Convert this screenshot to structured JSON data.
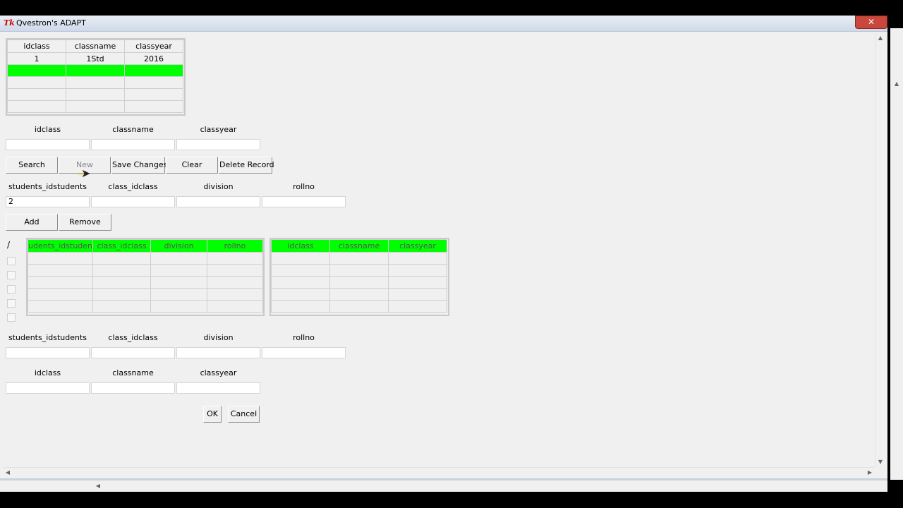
{
  "window": {
    "title": "Qvestron's ADAPT",
    "app_icon": "Tk",
    "close_glyph": "✕"
  },
  "class_grid": {
    "columns": [
      "idclass",
      "classname",
      "classyear"
    ],
    "rows": [
      [
        "1",
        "1Std",
        "2016"
      ]
    ]
  },
  "class_form": {
    "labels": [
      "idclass",
      "classname",
      "classyear"
    ],
    "values": [
      "",
      "",
      ""
    ]
  },
  "toolbar": {
    "search": "Search",
    "new": "New",
    "save": "Save Changes",
    "clear": "Clear",
    "delete": "Delete Record"
  },
  "student_form": {
    "labels": [
      "students_idstudents",
      "class_idclass",
      "division",
      "rollno"
    ],
    "values": [
      "2",
      "",
      "",
      ""
    ]
  },
  "student_actions": {
    "add": "Add",
    "remove": "Remove"
  },
  "check_header": "/",
  "students_grid": {
    "columns": [
      "udents_idstuden",
      "class_idclass",
      "division",
      "rollno"
    ]
  },
  "classes_grid": {
    "columns": [
      "idclass",
      "classname",
      "classyear"
    ]
  },
  "student_form2": {
    "labels": [
      "students_idstudents",
      "class_idclass",
      "division",
      "rollno"
    ],
    "values": [
      "",
      "",
      "",
      ""
    ]
  },
  "class_form2": {
    "labels": [
      "idclass",
      "classname",
      "classyear"
    ],
    "values": [
      "",
      "",
      ""
    ]
  },
  "dialog": {
    "ok": "OK",
    "cancel": "Cancel"
  },
  "colors": {
    "highlight": "#00ff00",
    "close": "#c9473b"
  }
}
